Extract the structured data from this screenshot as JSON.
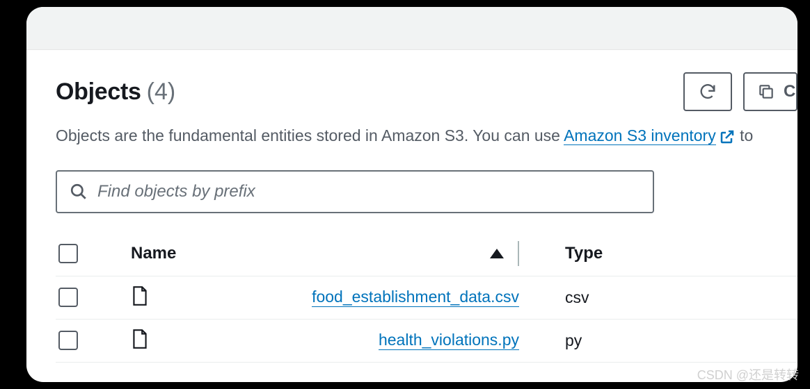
{
  "header": {
    "title": "Objects",
    "count": "(4)"
  },
  "actions": {
    "refresh_label": "Refresh",
    "copy_label": "Co"
  },
  "description": {
    "prefix": "Objects are the fundamental entities stored in Amazon S3. You can use ",
    "link_text": "Amazon S3 inventory",
    "suffix": " to"
  },
  "search": {
    "placeholder": "Find objects by prefix"
  },
  "table": {
    "columns": {
      "name": "Name",
      "type": "Type"
    },
    "rows": [
      {
        "name": "food_establishment_data.csv",
        "type": "csv"
      },
      {
        "name": "health_violations.py",
        "type": "py"
      }
    ]
  },
  "watermark": "CSDN @还是转转"
}
